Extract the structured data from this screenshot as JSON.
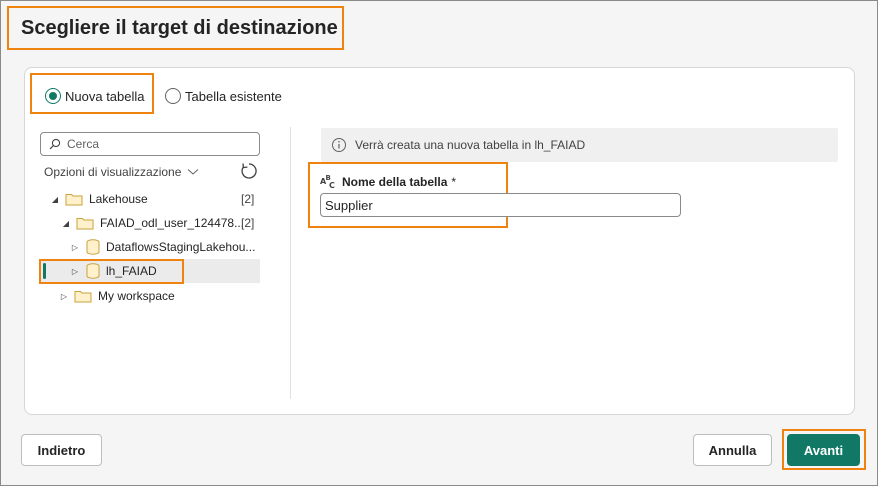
{
  "dialog": {
    "title": "Scegliere il target di destinazione"
  },
  "radio": {
    "new_table": "Nuova tabella",
    "existing_table": "Tabella esistente",
    "selected": "new_table"
  },
  "search": {
    "placeholder": "Cerca"
  },
  "view_options": {
    "label": "Opzioni di visualizzazione"
  },
  "tree": {
    "items": [
      {
        "label": "Lakehouse",
        "count": "[2]",
        "icon": "folder-icon",
        "expanded": true
      },
      {
        "label": "FAIAD_odl_user_124478...",
        "count": "[2]",
        "icon": "folder-icon",
        "expanded": true
      },
      {
        "label": "DataflowsStagingLakehou...",
        "icon": "database-icon",
        "expanded": false
      },
      {
        "label": "lh_FAIAD",
        "icon": "database-icon",
        "expanded": false,
        "selected": true
      },
      {
        "label": "My workspace",
        "icon": "folder-icon",
        "expanded": false
      }
    ]
  },
  "info": {
    "message": "Verrà creata una nuova tabella in lh_FAIAD"
  },
  "table_name": {
    "label": "Nome della tabella",
    "required_mark": "*",
    "value": "Supplier"
  },
  "footer": {
    "back_label": "Indietro",
    "cancel_label": "Annulla",
    "next_label": "Avanti"
  },
  "colors": {
    "accent": "#117865",
    "highlight": "#f0820f"
  }
}
